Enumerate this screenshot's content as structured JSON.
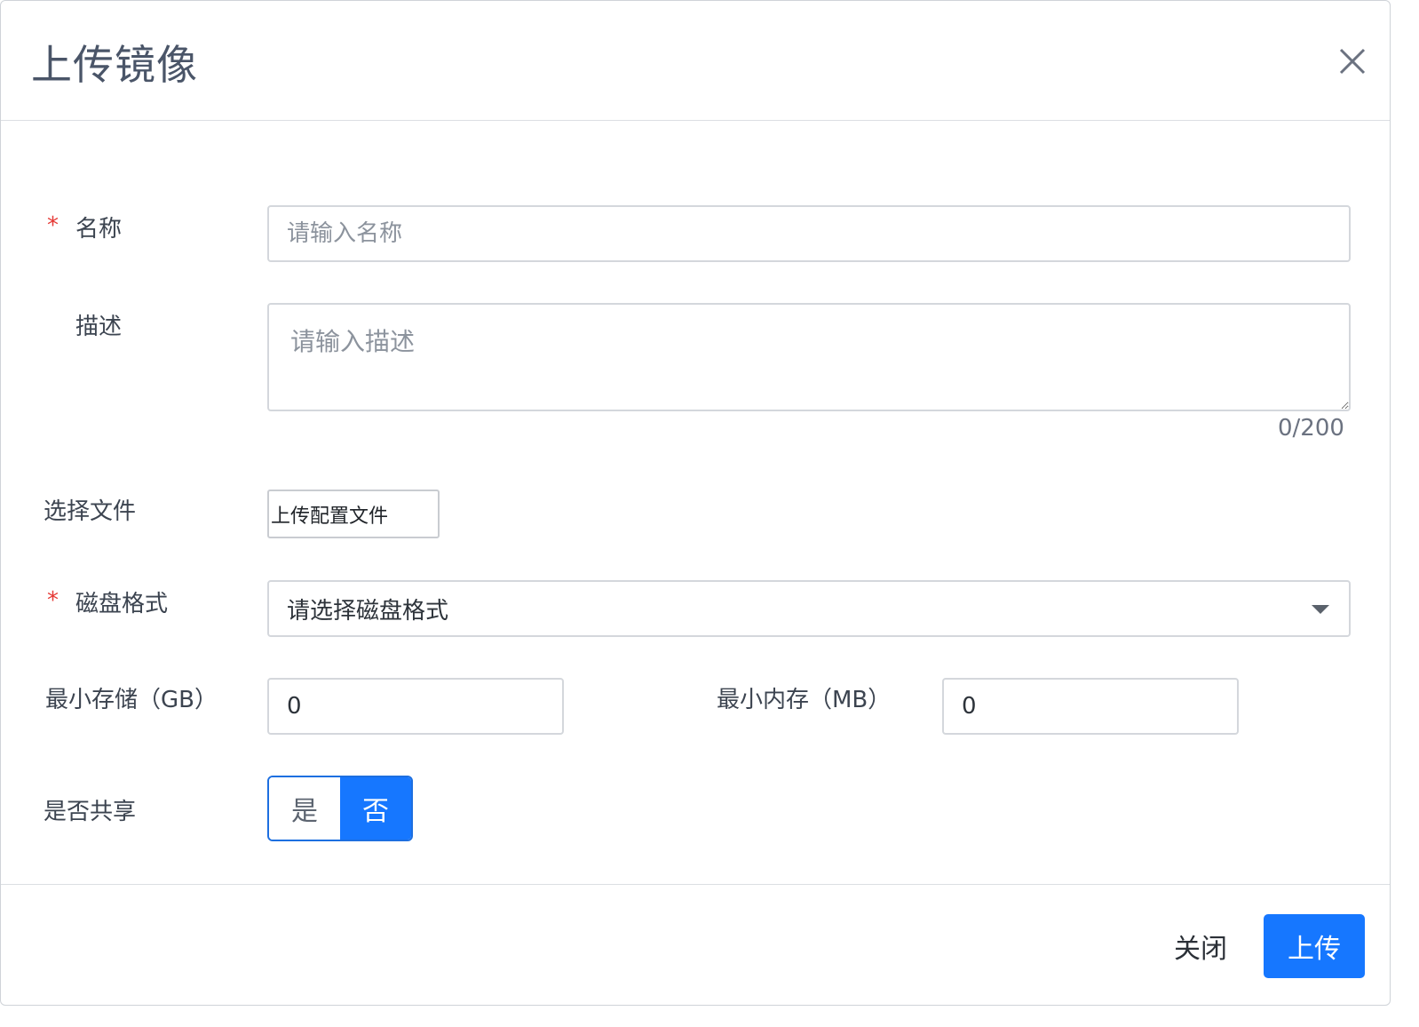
{
  "dialog": {
    "title": "上传镜像",
    "close_icon": "close-icon"
  },
  "form": {
    "required_mark": "*",
    "name": {
      "label": "名称",
      "placeholder": "请输入名称",
      "value": ""
    },
    "description": {
      "label": "描述",
      "placeholder": "请输入描述",
      "value": "",
      "counter": "0/200"
    },
    "file": {
      "label": "选择文件",
      "button_label": "上传配置文件"
    },
    "disk_format": {
      "label": "磁盘格式",
      "selected": "请选择磁盘格式",
      "icon": "chevron-down-icon"
    },
    "min_storage": {
      "label": "最小存储（GB）",
      "value": "0"
    },
    "min_memory": {
      "label": "最小内存（MB）",
      "value": "0"
    },
    "shared": {
      "label": "是否共享",
      "options": [
        "是",
        "否"
      ],
      "selected": "否"
    }
  },
  "footer": {
    "close_label": "关闭",
    "upload_label": "上传"
  },
  "colors": {
    "primary": "#1677ff",
    "required": "#e53935"
  }
}
